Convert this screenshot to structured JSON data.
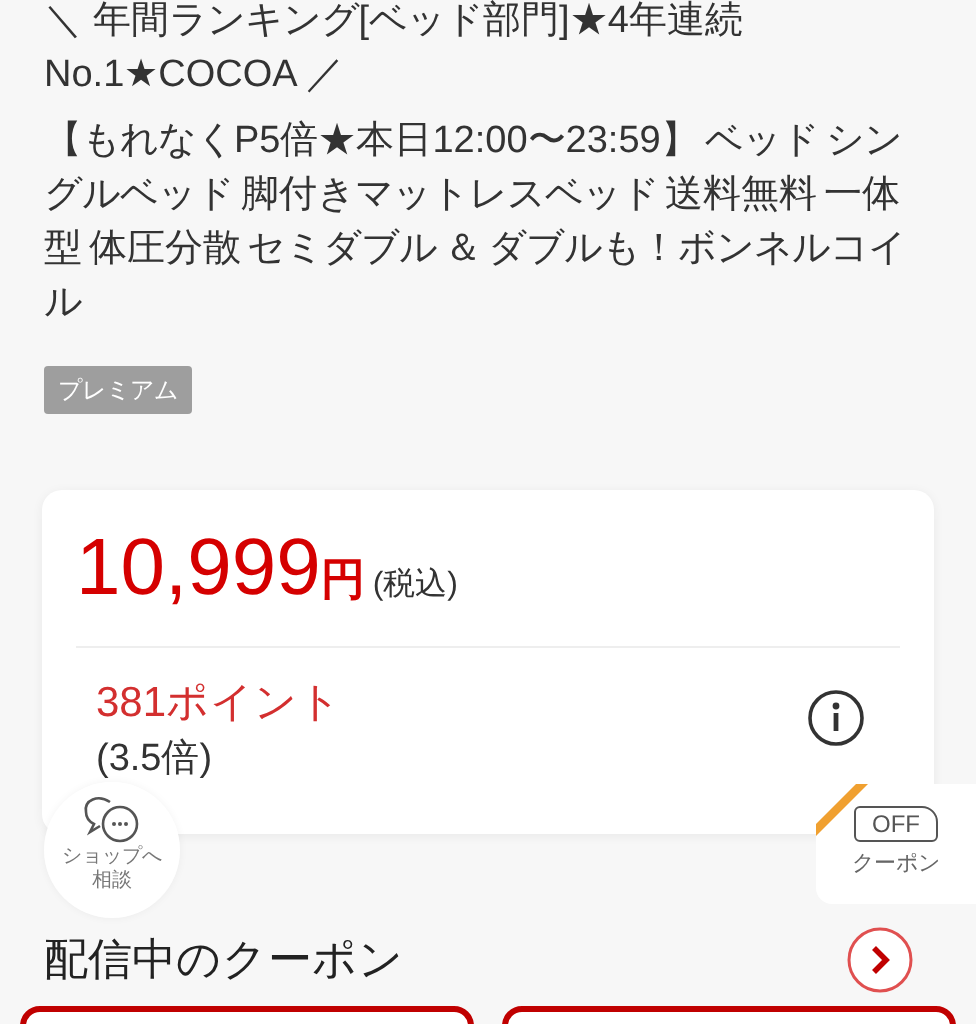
{
  "catch_copy": [
    "＼ 年間ランキング[ベッド部門]★4年連続",
    "No.1★COCOA ／"
  ],
  "title": "【もれなくP5倍★本日12:00〜23:59】 ベッド シングルベッド 脚付きマットレスベッド 送料無料 一体型 体圧分散 セミダブル ＆ ダブルも！ボンネルコイル",
  "badge": "プレミアム",
  "price": {
    "amount": "10,999",
    "unit": "円",
    "tax": "(税込)"
  },
  "points": {
    "amount": "381ポイント",
    "rate": "(3.5倍)"
  },
  "chat_button": {
    "label": "ショップへ相談"
  },
  "coupon_tab": {
    "icon_text": "OFF",
    "label": "クーポン"
  },
  "coupon_section": {
    "heading": "配信中のクーポン"
  }
}
